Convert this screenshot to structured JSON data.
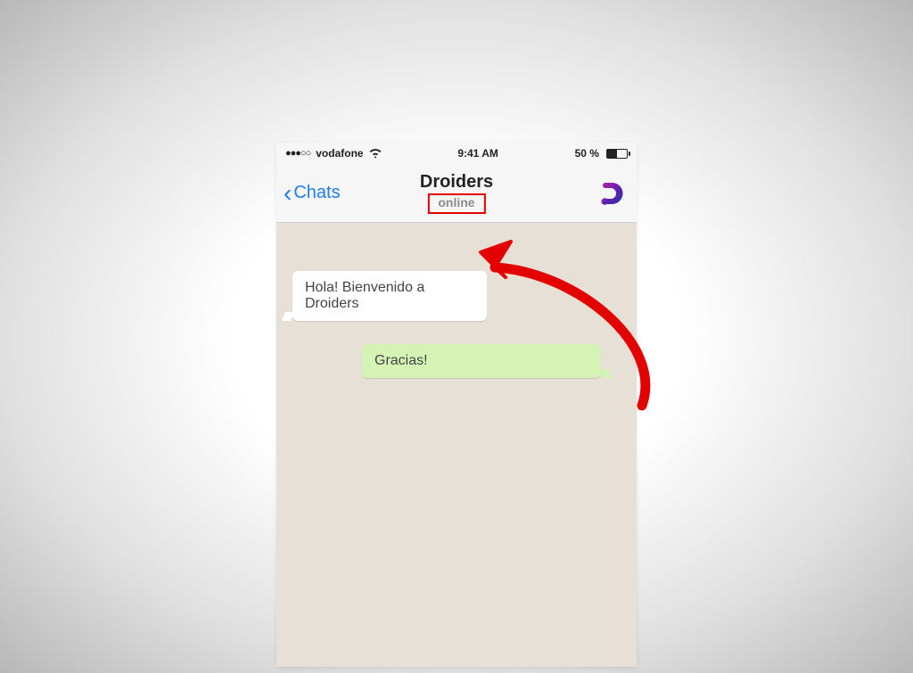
{
  "statusbar": {
    "carrier": "vodafone",
    "signal_dots": "●●●○○",
    "time": "9:41 AM",
    "battery_percent": "50 %"
  },
  "header": {
    "back_label": "Chats",
    "contact_name": "Droiders",
    "online_status": "online"
  },
  "messages": [
    {
      "direction": "in",
      "text": "Hola! Bienvenido a Droiders"
    },
    {
      "direction": "out",
      "text": "Gracias!"
    }
  ],
  "annotation": {
    "highlight_target": "online-status",
    "arrow_color": "#e20000"
  }
}
